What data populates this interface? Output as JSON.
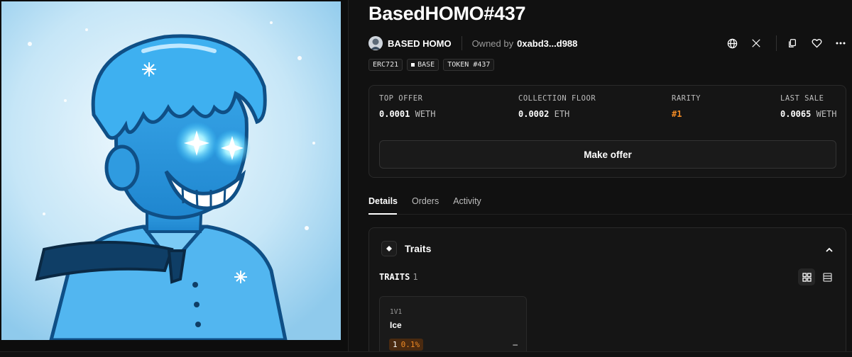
{
  "nft": {
    "title": "BasedHOMO#437",
    "collection": "BASED HOMO",
    "owned_label": "Owned by",
    "owner": "0xabd3...d988"
  },
  "badges": [
    "ERC721",
    "BASE",
    "TOKEN #437"
  ],
  "stats": {
    "top_offer": {
      "label": "TOP OFFER",
      "value": "0.0001",
      "unit": "WETH"
    },
    "floor": {
      "label": "COLLECTION FLOOR",
      "value": "0.0002",
      "unit": "ETH"
    },
    "rarity": {
      "label": "RARITY",
      "value": "#1"
    },
    "last_sale": {
      "label": "LAST SALE",
      "value": "0.0065",
      "unit": "WETH"
    }
  },
  "make_offer_label": "Make offer",
  "tabs": [
    {
      "label": "Details",
      "active": true
    },
    {
      "label": "Orders",
      "active": false
    },
    {
      "label": "Activity",
      "active": false
    }
  ],
  "traits": {
    "header": "Traits",
    "count_label": "TRAITS",
    "count": "1",
    "items": [
      {
        "type": "1V1",
        "value": "Ice",
        "count": "1",
        "pct": "0.1%",
        "extra": "–"
      }
    ]
  },
  "icons": {
    "website": "globe-icon",
    "x": "x-logo-icon",
    "copy": "copy-icon",
    "favorite": "heart-icon",
    "more": "more-icon"
  },
  "colors": {
    "background": "#111111",
    "accent_orange": "#f08a24",
    "ice_blue": "#2b9be0"
  }
}
